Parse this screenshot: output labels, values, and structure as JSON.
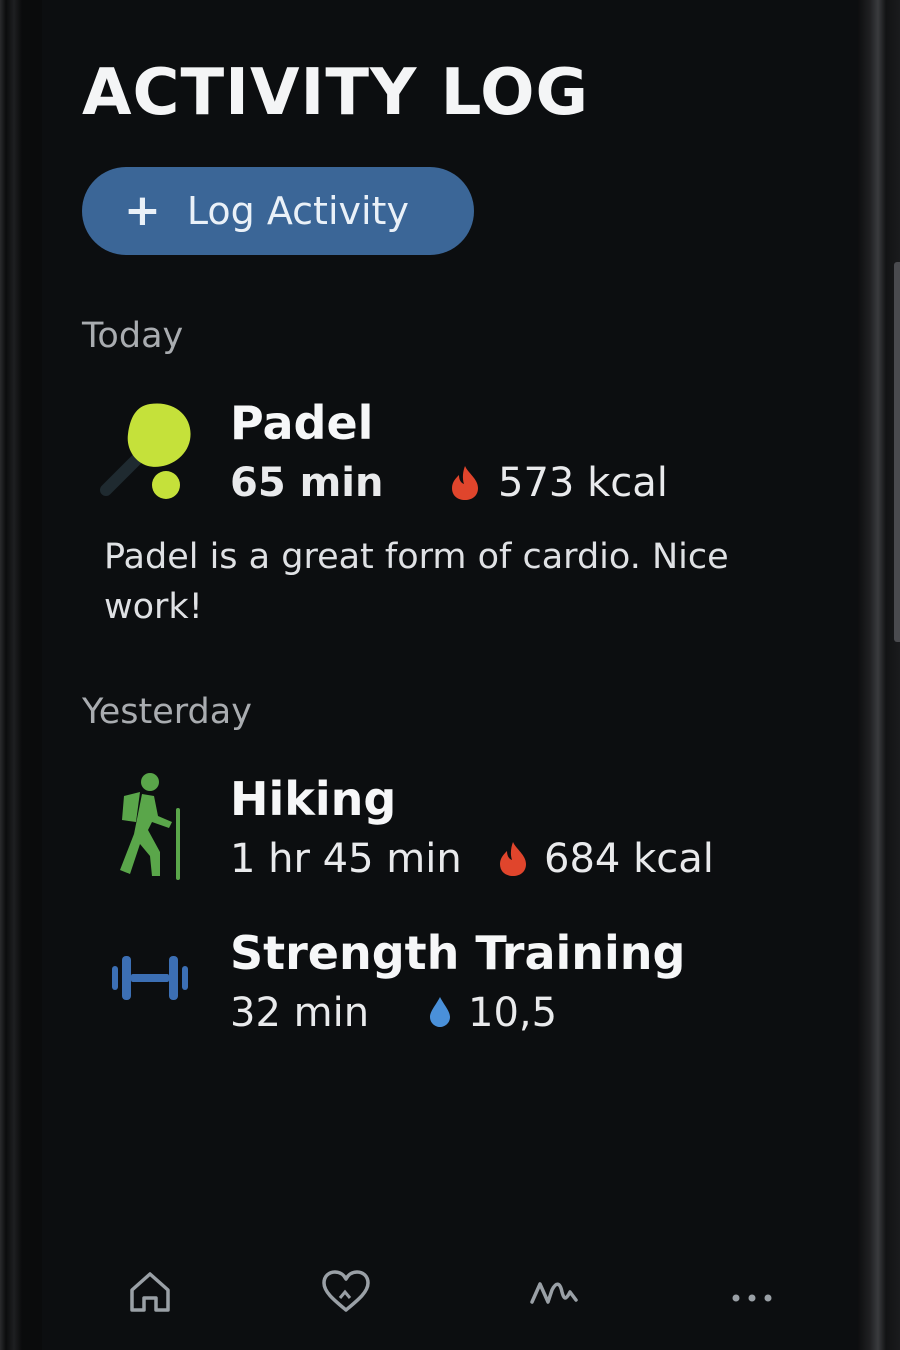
{
  "page": {
    "title": "ACTIVITY LOG",
    "log_button": {
      "icon": "plus-icon",
      "label": "Log Activity"
    }
  },
  "sections": [
    {
      "label": "Today",
      "activities": [
        {
          "name": "Padel",
          "icon": "padel-racket-icon",
          "duration": "65 min",
          "metric_icon": "flame-icon",
          "metric": "573 kcal",
          "note": "Padel is a great form of cardio. Nice work!"
        }
      ]
    },
    {
      "label": "Yesterday",
      "activities": [
        {
          "name": "Hiking",
          "icon": "hiker-icon",
          "duration": "1 hr 45 min",
          "metric_icon": "flame-icon",
          "metric": "684 kcal"
        },
        {
          "name": "Strength Training",
          "icon": "dumbbell-icon",
          "duration": "32 min",
          "metric_icon": "water-drop-icon",
          "metric": "10,5"
        }
      ]
    }
  ],
  "nav": [
    {
      "icon": "home-icon"
    },
    {
      "icon": "heart-icon"
    },
    {
      "icon": "activity-wave-icon"
    },
    {
      "icon": "more-icon"
    }
  ],
  "colors": {
    "background": "#0c0e10",
    "button": "#3b6697",
    "flame": "#e0452c",
    "drop": "#4a90d9",
    "padel": "#c5e13a",
    "hiker": "#5aa64a",
    "dumbbell": "#3c6fb4"
  }
}
